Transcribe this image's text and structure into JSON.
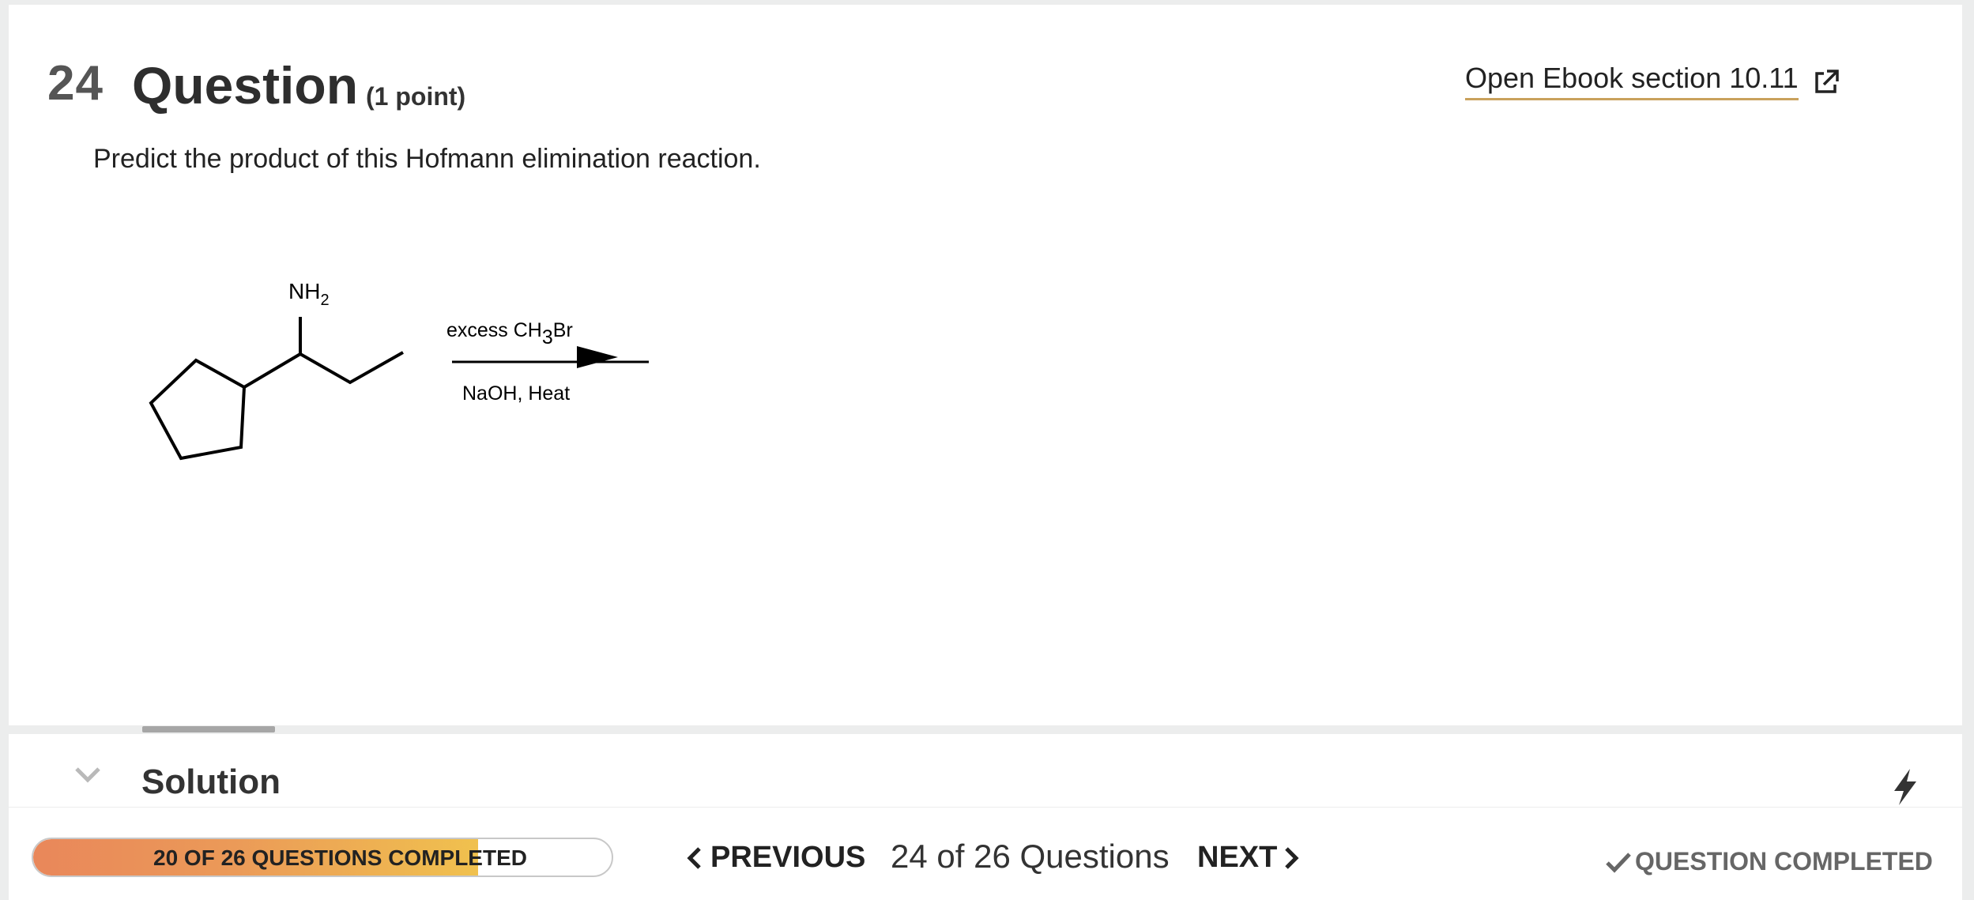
{
  "question": {
    "number": "24",
    "title": "Question",
    "points": "(1 point)",
    "prompt": "Predict the product of this Hofmann elimination reaction.",
    "ebook_link": "Open Ebook section 10.11"
  },
  "reaction": {
    "substituent": "NH",
    "substituent_subscript": "2",
    "reagent_top_prefix": "excess CH",
    "reagent_top_subscript": "3",
    "reagent_top_suffix": "Br",
    "reagent_bottom": "NaOH, Heat"
  },
  "solution": {
    "label": "Solution"
  },
  "footer": {
    "progress_label": "20 OF 26 QUESTIONS COMPLETED",
    "progress_fraction": 0.7692,
    "previous_label": "PREVIOUS",
    "page_count": "24 of 26 Questions",
    "next_label": "NEXT",
    "status_label": "QUESTION COMPLETED"
  },
  "icons": {
    "external_link": "external-link-icon",
    "chevron_down": "chevron-down-icon",
    "bolt": "bolt-icon",
    "chevron_left": "chevron-left-icon",
    "chevron_right": "chevron-right-icon",
    "check": "check-icon"
  },
  "colors": {
    "link_underline": "#c9a15c",
    "progress_start": "#e9875a",
    "progress_end": "#f0c14e"
  }
}
